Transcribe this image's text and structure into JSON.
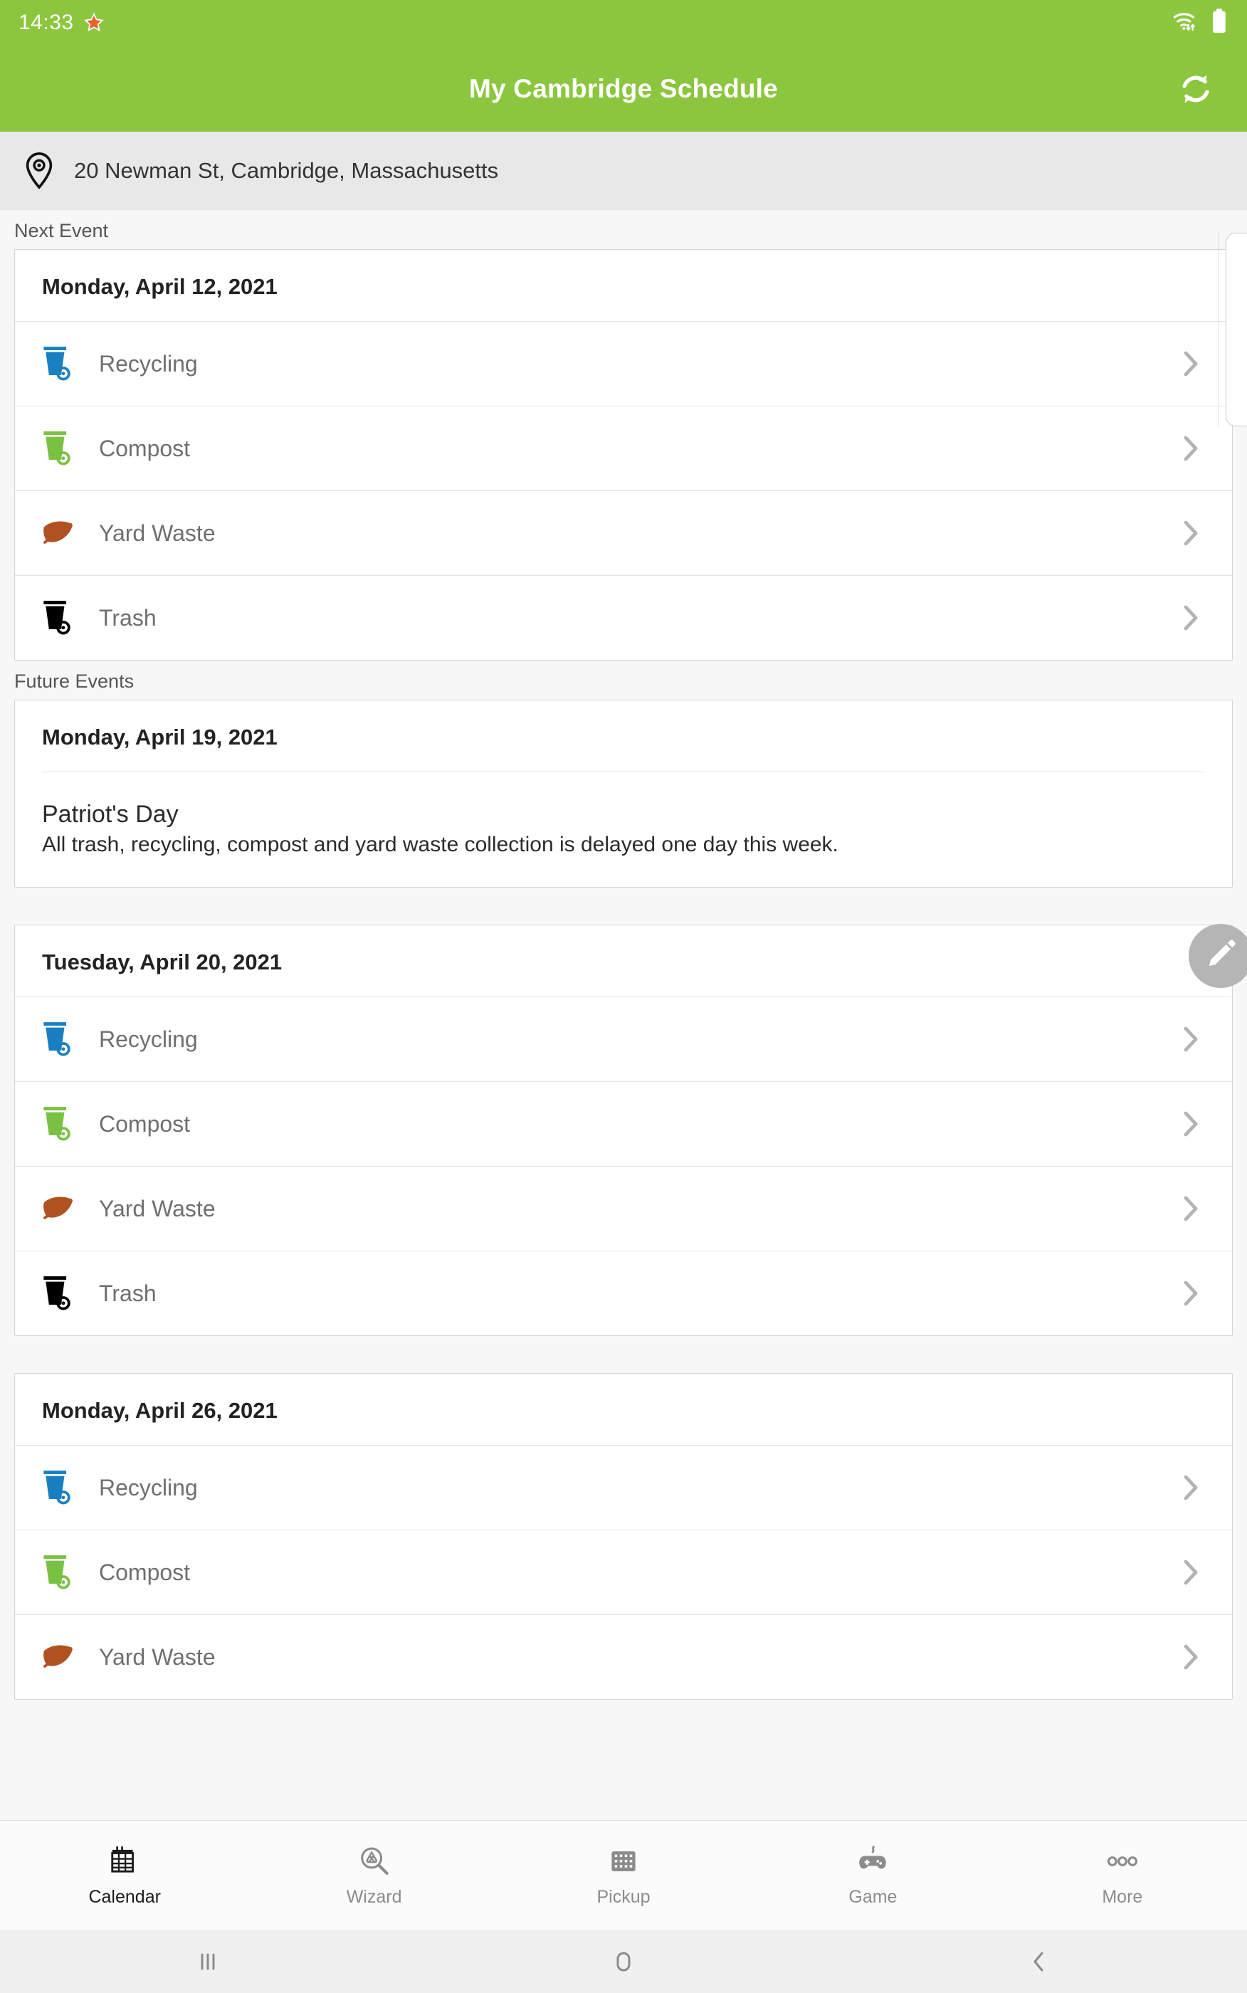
{
  "status_bar": {
    "time": "14:33",
    "star_icon": "star-icon",
    "wifi_icon": "wifi-icon",
    "battery_icon": "battery-icon"
  },
  "app_bar": {
    "title": "My Cambridge Schedule",
    "refresh_icon": "refresh-icon",
    "background_color": "#8CC63F"
  },
  "address_bar": {
    "pin_icon": "location-pin-icon",
    "address": "20 Newman St, Cambridge, Massachusetts"
  },
  "sections": {
    "next_event_label": "Next Event",
    "future_events_label": "Future Events"
  },
  "next_event_card": {
    "date": "Monday, April 12, 2021",
    "rows": [
      {
        "label": "Recycling",
        "icon": "recycling-bin-icon",
        "color": "#1a7fc1"
      },
      {
        "label": "Compost",
        "icon": "compost-bin-icon",
        "color": "#7ac143"
      },
      {
        "label": "Yard Waste",
        "icon": "leaf-icon",
        "color": "#b0521f"
      },
      {
        "label": "Trash",
        "icon": "trash-bin-icon",
        "color": "#000000"
      }
    ]
  },
  "future_cards": [
    {
      "date": "Monday, April 19, 2021",
      "notice_title": "Patriot's Day",
      "notice_body": "All trash, recycling, compost and yard waste collection is delayed one day this week.",
      "rows": []
    },
    {
      "date": "Tuesday, April 20, 2021",
      "notice_title": "",
      "notice_body": "",
      "rows": [
        {
          "label": "Recycling",
          "icon": "recycling-bin-icon",
          "color": "#1a7fc1"
        },
        {
          "label": "Compost",
          "icon": "compost-bin-icon",
          "color": "#7ac143"
        },
        {
          "label": "Yard Waste",
          "icon": "leaf-icon",
          "color": "#b0521f"
        },
        {
          "label": "Trash",
          "icon": "trash-bin-icon",
          "color": "#000000"
        }
      ]
    },
    {
      "date": "Monday, April 26, 2021",
      "notice_title": "",
      "notice_body": "",
      "rows": [
        {
          "label": "Recycling",
          "icon": "recycling-bin-icon",
          "color": "#1a7fc1"
        },
        {
          "label": "Compost",
          "icon": "compost-bin-icon",
          "color": "#7ac143"
        },
        {
          "label": "Yard Waste",
          "icon": "leaf-icon",
          "color": "#b0521f"
        }
      ]
    }
  ],
  "fab": {
    "icon": "pencil-edit-icon",
    "color": "#b5b5b5"
  },
  "tab_bar": {
    "active_index": 0,
    "items": [
      {
        "label": "Calendar",
        "icon": "calendar-icon"
      },
      {
        "label": "Wizard",
        "icon": "recycle-search-icon"
      },
      {
        "label": "Pickup",
        "icon": "pickup-grid-icon"
      },
      {
        "label": "Game",
        "icon": "gamepad-icon"
      },
      {
        "label": "More",
        "icon": "more-dots-icon"
      }
    ]
  },
  "system_nav": {
    "recents_icon": "recents-icon",
    "home_icon": "home-icon",
    "back_icon": "back-icon"
  }
}
